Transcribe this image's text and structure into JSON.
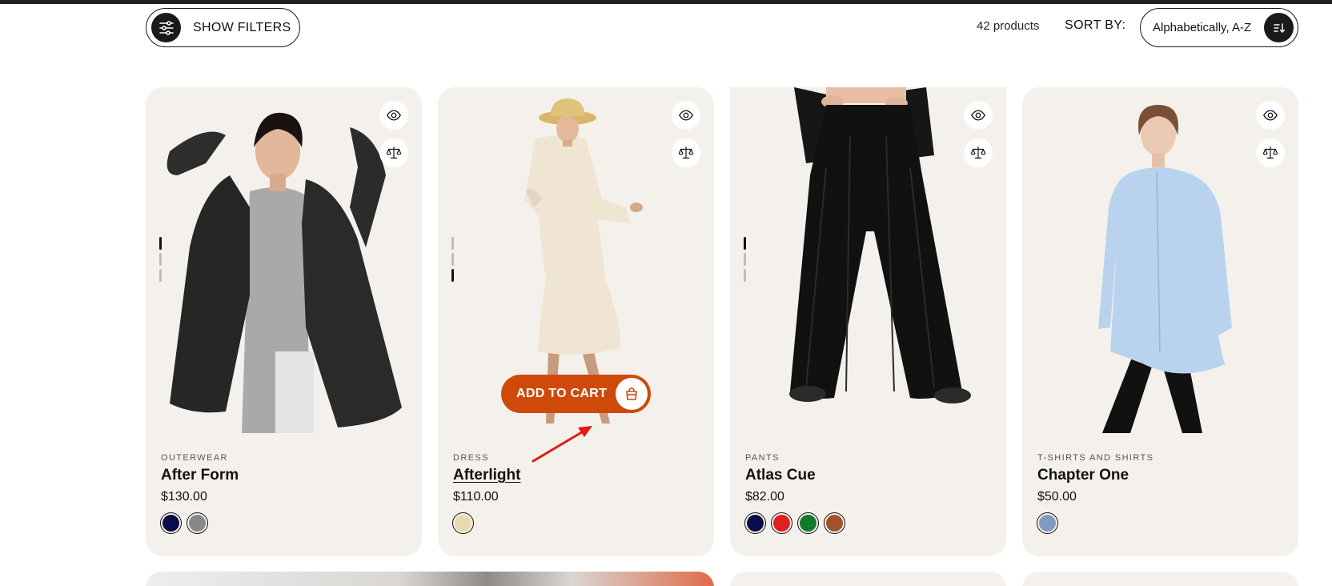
{
  "toolbar": {
    "filters_label": "SHOW FILTERS",
    "product_count": "42 products",
    "sort_label": "SORT BY:",
    "sort_value": "Alphabetically, A-Z"
  },
  "colors": {
    "accent": "#cf4a0a",
    "card_bg": "#f4f1ec",
    "dark": "#1a1a1a"
  },
  "products": [
    {
      "category": "OUTERWEAR",
      "name": "After Form",
      "price": "$130.00",
      "swatches": [
        "#0b0b4a",
        "#888888"
      ],
      "active_dot": 0
    },
    {
      "category": "DRESS",
      "name": "Afterlight",
      "price": "$110.00",
      "swatches": [
        "#e8d9b0"
      ],
      "active_dot": 2
    },
    {
      "category": "PANTS",
      "name": "Atlas Cue",
      "price": "$82.00",
      "swatches": [
        "#0b0b4a",
        "#e02020",
        "#127a2a",
        "#a0532a"
      ],
      "active_dot": 0
    },
    {
      "category": "T-SHIRTS AND SHIRTS",
      "name": "Chapter One",
      "price": "$50.00",
      "swatches": [
        "#7f9cc0"
      ],
      "active_dot": -1
    }
  ],
  "add_to_cart_label": "ADD TO CART"
}
